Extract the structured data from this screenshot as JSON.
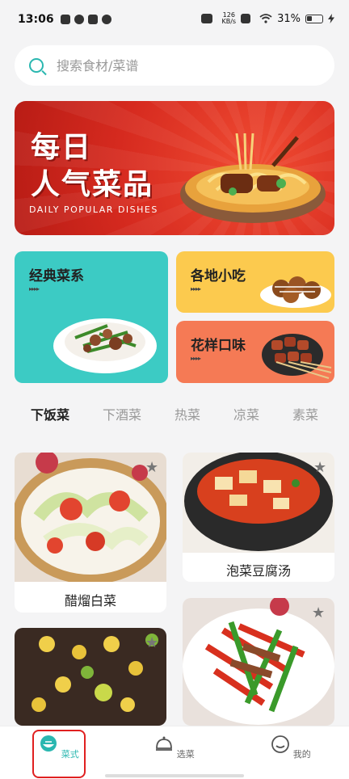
{
  "status": {
    "time": "13:06",
    "speed_top": "126",
    "speed_bottom": "KB/s",
    "battery": "31%"
  },
  "search": {
    "placeholder": "搜索食材/菜谱"
  },
  "banner": {
    "line1": "每日",
    "line2": "人气菜品",
    "subtitle": "DAILY POPULAR DISHES"
  },
  "categories": [
    {
      "label": "经典菜系",
      "dots": "▸▸▸▸"
    },
    {
      "label": "各地小吃",
      "dots": "▸▸▸▸"
    },
    {
      "label": "花样口味",
      "dots": "▸▸▸▸"
    }
  ],
  "tabs": [
    {
      "label": "下饭菜",
      "active": true
    },
    {
      "label": "下酒菜"
    },
    {
      "label": "热菜"
    },
    {
      "label": "凉菜"
    },
    {
      "label": "素菜"
    }
  ],
  "dishes": [
    {
      "name": "醋熘白菜"
    },
    {
      "name": "泡菜豆腐汤"
    }
  ],
  "nav": [
    {
      "label": "菜式",
      "icon": "bowl-icon",
      "active": true
    },
    {
      "label": "选菜",
      "icon": "cloche-icon"
    },
    {
      "label": "我的",
      "icon": "profile-icon"
    }
  ],
  "colors": {
    "accent": "#2ab7b0",
    "highlight": "#e02020"
  }
}
